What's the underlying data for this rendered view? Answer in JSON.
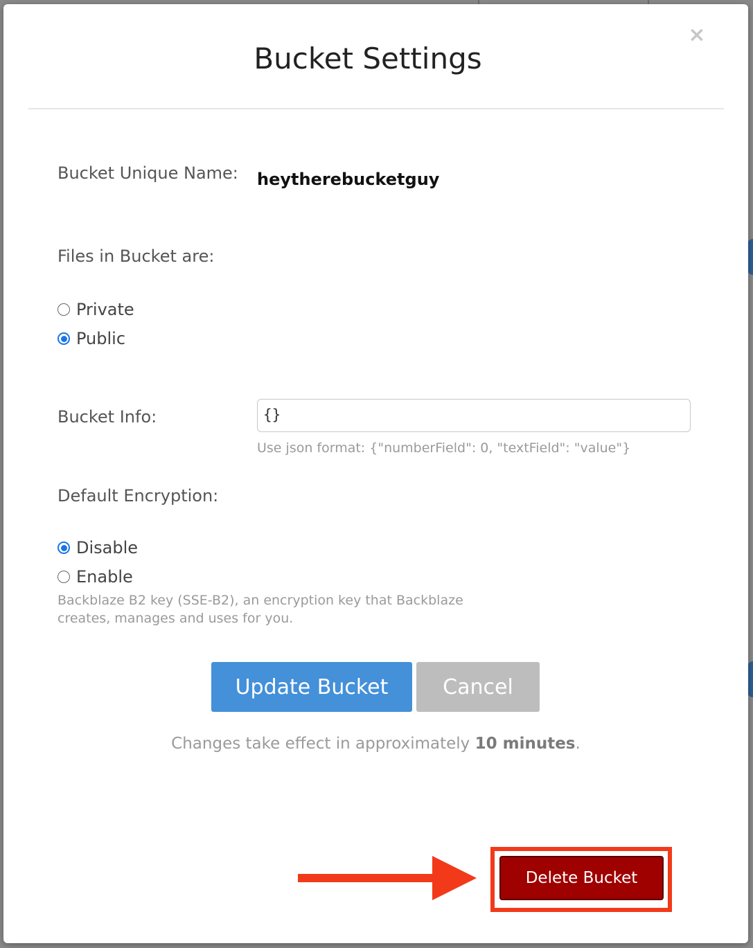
{
  "dialog": {
    "title": "Bucket Settings",
    "close_glyph": "×"
  },
  "bucket_name": {
    "label": "Bucket Unique Name:",
    "value": "heytherebucketguy"
  },
  "visibility": {
    "label": "Files in Bucket are:",
    "options": [
      {
        "label": "Private",
        "checked": false
      },
      {
        "label": "Public",
        "checked": true
      }
    ]
  },
  "bucket_info": {
    "label": "Bucket Info:",
    "value": "{}",
    "hint": "Use json format: {\"numberField\": 0, \"textField\": \"value\"}"
  },
  "encryption": {
    "label": "Default Encryption:",
    "options": [
      {
        "label": "Disable",
        "checked": true
      },
      {
        "label": "Enable",
        "checked": false
      }
    ],
    "hint_line1": "Backblaze B2 key (SSE-B2), an encryption key that Backblaze",
    "hint_line2": "creates, manages and uses for you."
  },
  "actions": {
    "update_label": "Update Bucket",
    "cancel_label": "Cancel",
    "delete_label": "Delete Bucket"
  },
  "note": {
    "prefix": "Changes take effect in approximately ",
    "emphasis": "10 minutes",
    "suffix": "."
  },
  "colors": {
    "accent_blue": "#4490d9",
    "radio_blue": "#1a73e8",
    "delete_red": "#9f0000",
    "annotation_red": "#f23a1a"
  },
  "icons": {
    "close": "close-icon",
    "annotation_arrow": "arrow-right-icon"
  }
}
